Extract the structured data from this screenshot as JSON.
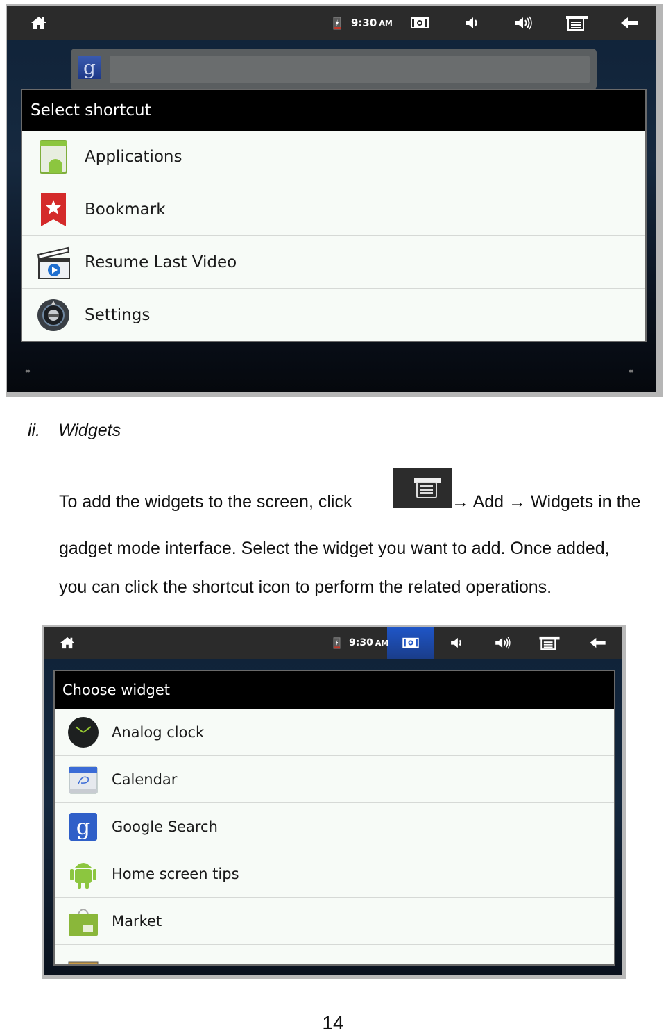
{
  "screenshot_1": {
    "statusbar": {
      "time": "9:30",
      "ampm": "AM",
      "icons": [
        "home-icon",
        "battery-icon",
        "screenshot-icon",
        "volume-down-icon",
        "volume-up-icon",
        "menu-icon",
        "back-icon"
      ]
    },
    "search_widget": {
      "logo": "g"
    },
    "dialog": {
      "title": "Select shortcut",
      "items": [
        {
          "label": "Applications",
          "icon": "applications-icon"
        },
        {
          "label": "Bookmark",
          "icon": "bookmark-icon"
        },
        {
          "label": "Resume Last Video",
          "icon": "video-clapper-icon"
        },
        {
          "label": "Settings",
          "icon": "settings-icon"
        }
      ]
    },
    "pager": {
      "left": "••",
      "right": "••"
    }
  },
  "section": {
    "number": "ii.",
    "title": "Widgets"
  },
  "paragraph": {
    "line1_before": "To add the widgets to the screen, click",
    "line1_after": "→ Add → Widgets in the",
    "line2": "gadget mode interface. Select the widget you want to add. Once added,",
    "line3": "you can click the shortcut icon to perform the related operations."
  },
  "screenshot_2": {
    "statusbar": {
      "time": "9:30",
      "ampm": "AM",
      "active_icon": "screenshot-icon",
      "active_color": "#1f56c8"
    },
    "dialog": {
      "title": "Choose widget",
      "items": [
        {
          "label": "Analog clock",
          "icon": "analog-clock-icon"
        },
        {
          "label": "Calendar",
          "icon": "calendar-icon"
        },
        {
          "label": "Google Search",
          "icon": "google-search-icon"
        },
        {
          "label": "Home screen tips",
          "icon": "android-robot-icon"
        },
        {
          "label": "Market",
          "icon": "market-bag-icon"
        },
        {
          "label": "",
          "icon": "picture-frame-icon"
        }
      ]
    }
  },
  "page_number": "14"
}
